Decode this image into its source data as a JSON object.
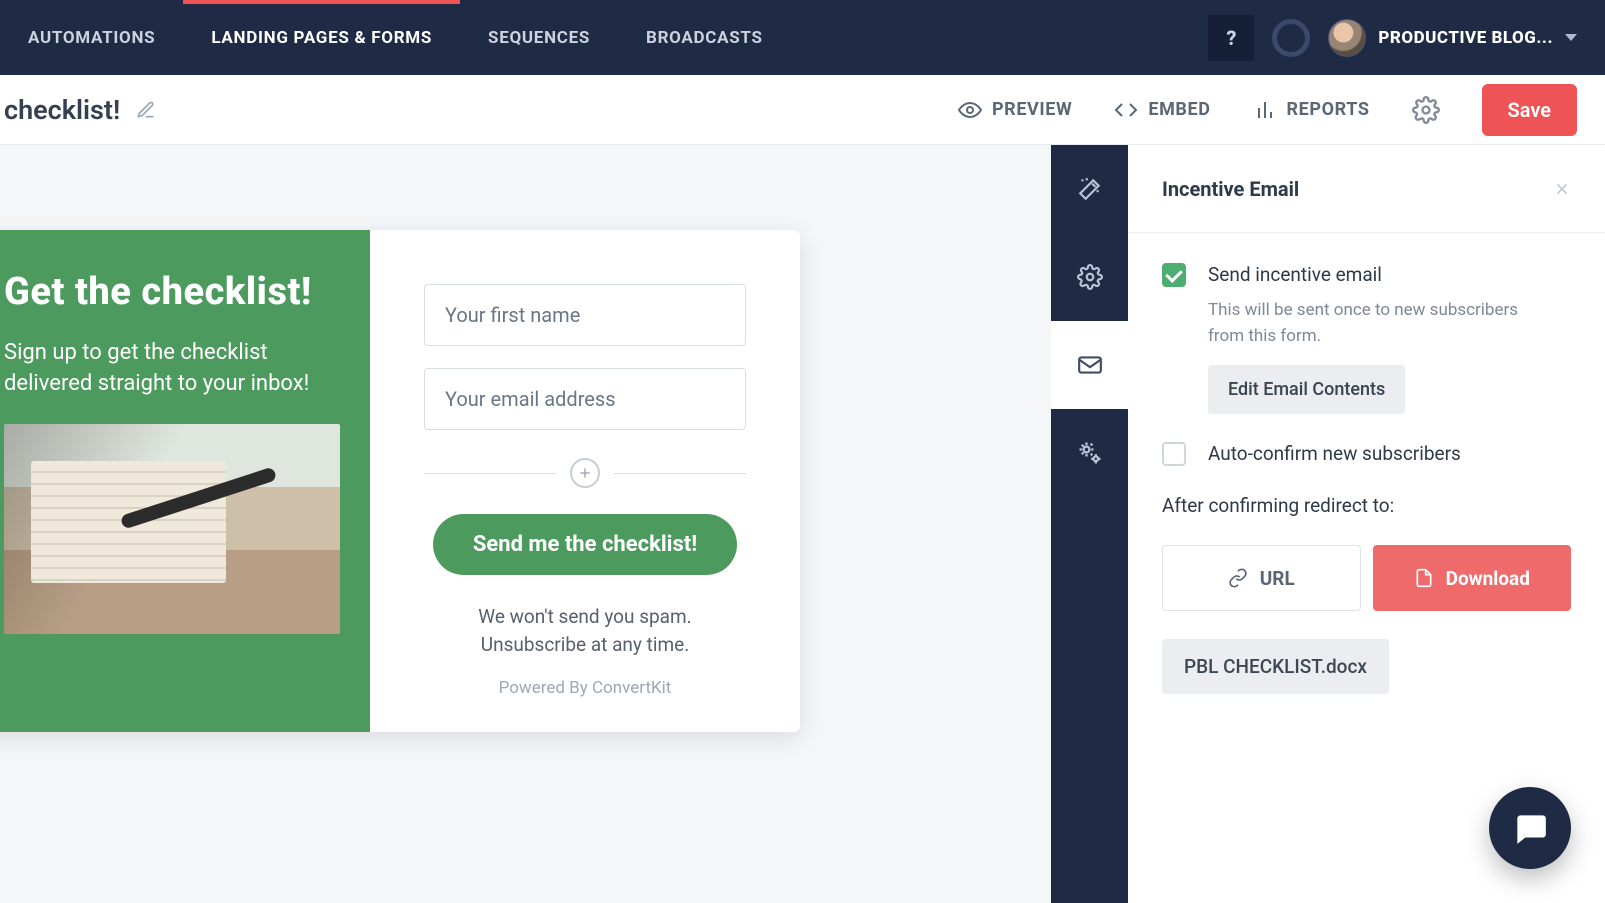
{
  "nav": {
    "items": [
      {
        "label": "AUTOMATIONS"
      },
      {
        "label": "LANDING PAGES & FORMS"
      },
      {
        "label": "SEQUENCES"
      },
      {
        "label": "BROADCASTS"
      }
    ],
    "help": "?",
    "account": "PRODUCTIVE BLOG..."
  },
  "subbar": {
    "title": " checklist!",
    "preview": "PREVIEW",
    "embed": "EMBED",
    "reports": "REPORTS",
    "save": "Save"
  },
  "form": {
    "headline": "Get the checklist!",
    "subhead": "Sign up to get the checklist delivered straight to your inbox!",
    "first_name_placeholder": "Your first name",
    "email_placeholder": "Your email address",
    "cta": "Send me the checklist!",
    "disclaimer1": "We won't send you spam.",
    "disclaimer2": "Unsubscribe at any time.",
    "poweredby": "Powered By ConvertKit"
  },
  "panel": {
    "title": "Incentive Email",
    "send_label": "Send incentive email",
    "send_hint": "This will be sent once to new subscribers from this form.",
    "edit_btn": "Edit Email Contents",
    "autoconfirm": "Auto-confirm new subscribers",
    "redirect_label": "After confirming redirect to:",
    "url": "URL",
    "download": "Download",
    "file": "PBL CHECKLIST.docx"
  }
}
